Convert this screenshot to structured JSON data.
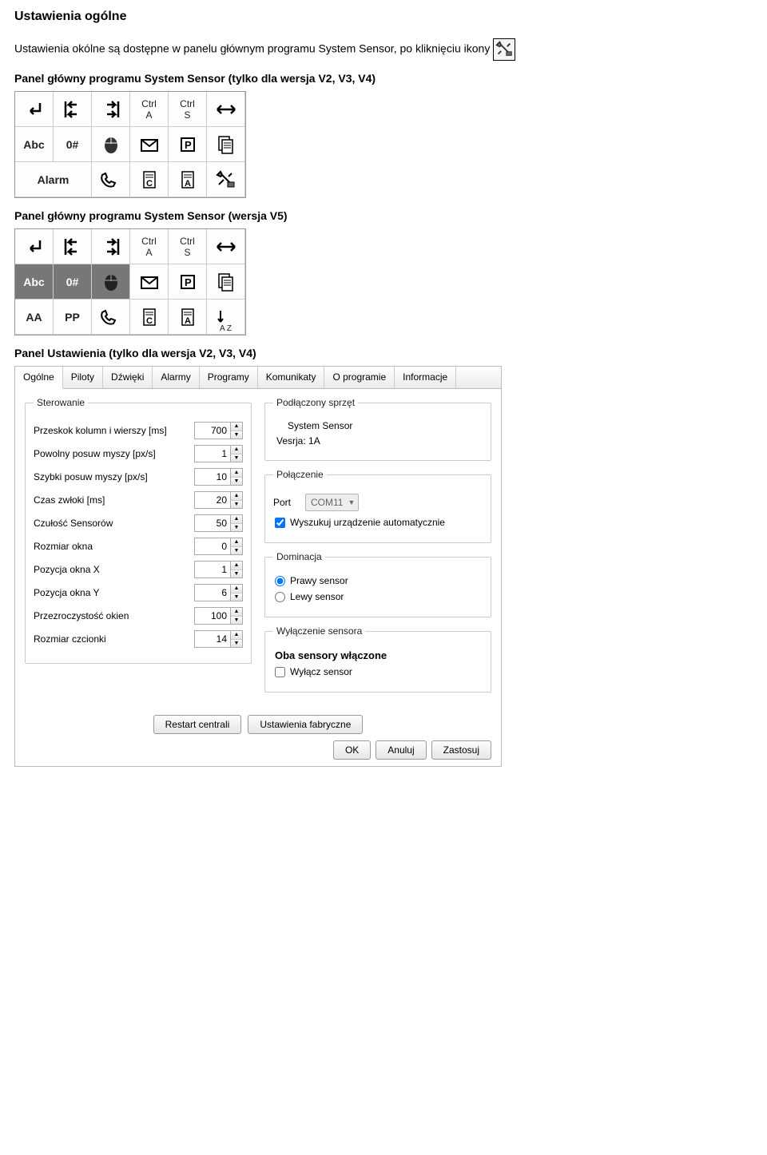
{
  "headings": {
    "title": "Ustawienia ogólne",
    "intro": "Ustawienia okólne są dostępne w panelu głównym programu System Sensor, po kliknięciu ikony",
    "panel_v234": "Panel główny programu System Sensor (tylko dla wersja V2, V3, V4)",
    "panel_v5": "Panel główny programu System Sensor (wersja V5)",
    "panel_settings": "Panel Ustawienia (tylko dla wersja V2, V3, V4)"
  },
  "toolbar_labels": {
    "ctrl_a": "Ctrl\nA",
    "ctrl_s": "Ctrl\nS",
    "abc": "Abc",
    "zerohash": "0#",
    "alarm": "Alarm",
    "aa": "AA",
    "pp": "PP",
    "az": "A Z"
  },
  "tabs": [
    "Ogólne",
    "Piloty",
    "Dźwięki",
    "Alarmy",
    "Programy",
    "Komunikaty",
    "O programie",
    "Informacje"
  ],
  "control_group": {
    "legend": "Sterowanie",
    "fields": [
      {
        "label": "Przeskok kolumn i wierszy [ms]",
        "value": "700"
      },
      {
        "label": "Powolny posuw myszy [px/s]",
        "value": "1"
      },
      {
        "label": "Szybki posuw myszy [px/s]",
        "value": "10"
      },
      {
        "label": "Czas zwłoki [ms]",
        "value": "20"
      },
      {
        "label": "Czułość Sensorów",
        "value": "50"
      },
      {
        "label": "Rozmiar okna",
        "value": "0"
      },
      {
        "label": "Pozycja okna X",
        "value": "1"
      },
      {
        "label": "Pozycja okna Y",
        "value": "6"
      },
      {
        "label": "Przezroczystość okien",
        "value": "100"
      },
      {
        "label": "Rozmiar czcionki",
        "value": "14"
      }
    ]
  },
  "device_group": {
    "legend": "Podłączony sprzęt",
    "device_name": "System Sensor",
    "version_label": "Vesrja: 1A"
  },
  "connection_group": {
    "legend": "Połączenie",
    "port_label": "Port",
    "port_value": "COM11",
    "auto_search": "Wyszukuj urządzenie automatycznie"
  },
  "domination_group": {
    "legend": "Dominacja",
    "right": "Prawy sensor",
    "left": "Lewy sensor"
  },
  "sensor_off_group": {
    "legend": "Wyłączenie sensora",
    "status": "Oba sensory włączone",
    "disable": "Wyłącz sensor"
  },
  "buttons": {
    "restart": "Restart centrali",
    "factory": "Ustawienia fabryczne",
    "ok": "OK",
    "cancel": "Anuluj",
    "apply": "Zastosuj"
  }
}
